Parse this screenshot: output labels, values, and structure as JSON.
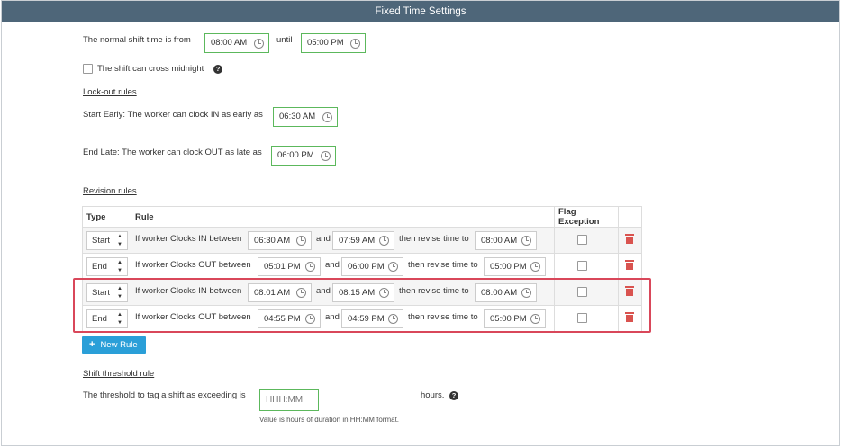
{
  "header": {
    "title": "Fixed Time Settings"
  },
  "shift": {
    "normal_label": "The normal shift time is from",
    "start_time": "08:00 AM",
    "until_label": "until",
    "end_time": "05:00 PM",
    "cross_midnight_label": "The shift can cross midnight",
    "cross_midnight_checked": false
  },
  "lockout": {
    "section_title": "Lock-out rules",
    "start_early_label": "Start Early: The worker can clock IN as early as",
    "start_early_time": "06:30 AM",
    "end_late_label": "End Late: The worker can clock OUT as late as",
    "end_late_time": "06:00 PM"
  },
  "revision": {
    "section_title": "Revision rules",
    "columns": [
      "Type",
      "Rule",
      "Flag Exception",
      ""
    ],
    "rows": [
      {
        "type": "Start",
        "prefix": "If worker Clocks IN between",
        "from": "06:30 AM",
        "and": "and",
        "to": "07:59 AM",
        "then": "then revise time to",
        "revise": "08:00 AM",
        "flag": false,
        "highlighted": false
      },
      {
        "type": "End",
        "prefix": "If worker Clocks OUT between",
        "from": "05:01 PM",
        "and": "and",
        "to": "06:00 PM",
        "then": "then revise time to",
        "revise": "05:00 PM",
        "flag": false,
        "highlighted": false
      },
      {
        "type": "Start",
        "prefix": "If worker Clocks IN between",
        "from": "08:01 AM",
        "and": "and",
        "to": "08:15 AM",
        "then": "then revise time to",
        "revise": "08:00 AM",
        "flag": false,
        "highlighted": true
      },
      {
        "type": "End",
        "prefix": "If worker Clocks OUT between",
        "from": "04:55 PM",
        "and": "and",
        "to": "04:59 PM",
        "then": "then revise time to",
        "revise": "05:00 PM",
        "flag": false,
        "highlighted": true
      }
    ],
    "new_rule_label": "New Rule"
  },
  "threshold": {
    "section_title": "Shift threshold rule",
    "label": "The threshold to tag a shift as exceeding is",
    "placeholder": "HHH:MM",
    "unit": "hours.",
    "hint": "Value is hours of duration in HH:MM format."
  },
  "colors": {
    "header_bg": "#4e6679",
    "accent": "#2a9fd8",
    "valid_border": "#5cb85c",
    "highlight": "#d9475a",
    "delete": "#d9534f"
  },
  "icons": {
    "time": "clock-icon",
    "help": "question-circle-icon",
    "delete": "trash-icon",
    "add": "plus-icon",
    "select": "sort-caret-icon"
  }
}
